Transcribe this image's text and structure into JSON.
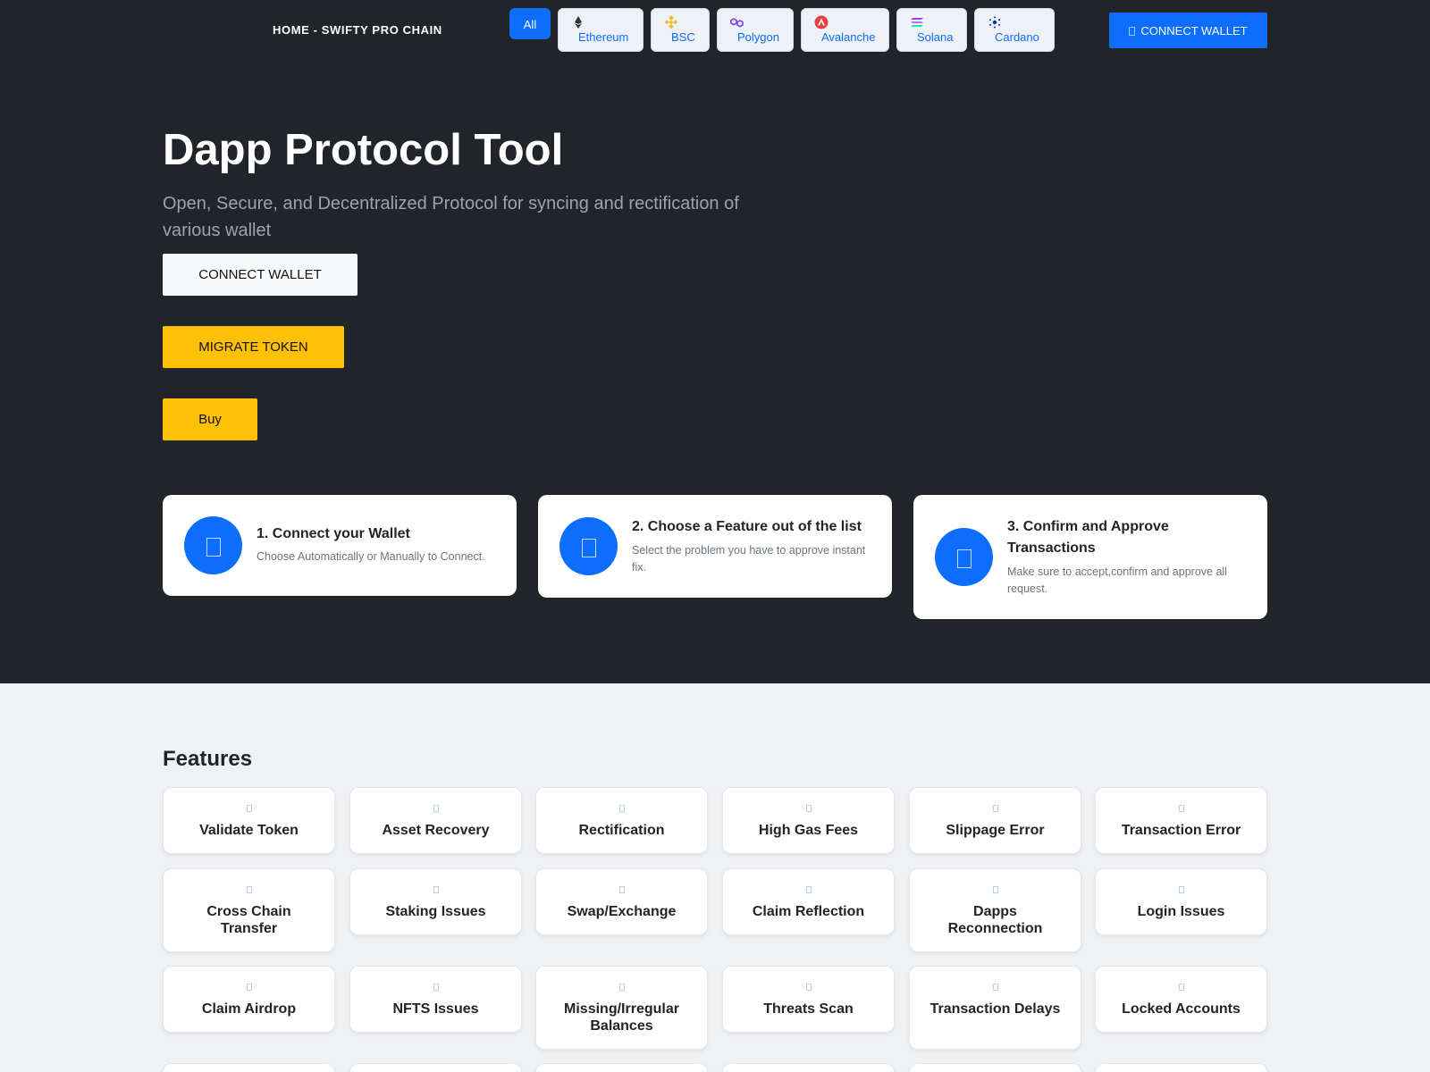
{
  "nav": {
    "brand": "HOME - SWIFTY PRO CHAIN",
    "chains": [
      {
        "label": "All",
        "icon": "all"
      },
      {
        "label": "Ethereum",
        "icon": "ethereum-icon"
      },
      {
        "label": "BSC",
        "icon": "bsc-icon"
      },
      {
        "label": "Polygon",
        "icon": "polygon-icon"
      },
      {
        "label": "Avalanche",
        "icon": "avalanche-icon"
      },
      {
        "label": "Solana",
        "icon": "solana-icon"
      },
      {
        "label": "Cardano",
        "icon": "cardano-icon"
      }
    ],
    "connect_label": "CONNECT WALLET"
  },
  "hero": {
    "title": "Dapp Protocol Tool",
    "subtitle": "Open, Secure, and Decentralized Protocol for syncing and rectification of various wallet",
    "connect_label": "CONNECT WALLET",
    "migrate_label": "MIGRATE TOKEN",
    "buy_label": "Buy"
  },
  "steps": [
    {
      "title": "1. Connect your Wallet",
      "desc": "Choose Automatically or Manually to Connect."
    },
    {
      "title": "2. Choose a Feature out of the list",
      "desc": "Select the problem you have to approve instant fix."
    },
    {
      "title": "3. Confirm and Approve Transactions",
      "desc": "Make sure to accept,confirm and approve all request."
    }
  ],
  "features": {
    "title": "Features",
    "items": [
      "Validate Token",
      "Asset Recovery",
      "Rectification",
      "High Gas Fees",
      "Slippage Error",
      "Transaction Error",
      "Cross Chain Transfer",
      "Staking Issues",
      "Swap/Exchange",
      "Claim Reflection",
      "Dapps Reconnection",
      "Login Issues",
      "Claim Airdrop",
      "NFTS Issues",
      "Missing/Irregular Balances",
      "Threats Scan",
      "Transaction Delays",
      "Locked Accounts"
    ]
  },
  "colors": {
    "hero_bg": "#212529",
    "primary": "#0d6efd",
    "warning": "#ffc107",
    "page_bg": "#f0f1f4"
  }
}
